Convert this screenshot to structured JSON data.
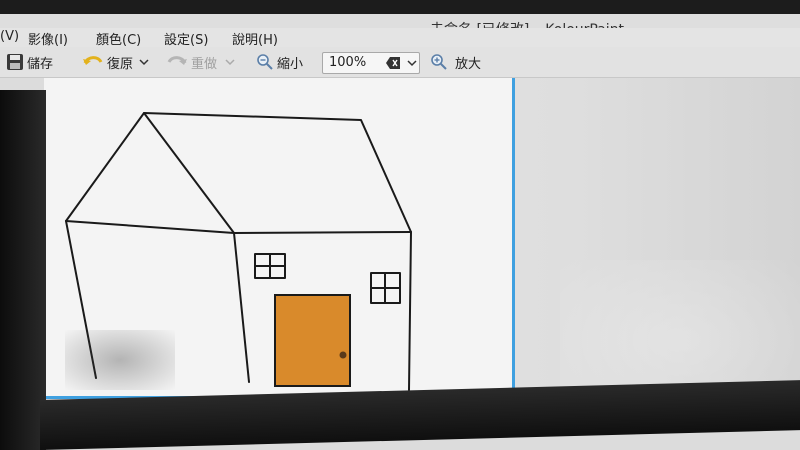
{
  "window": {
    "title": "未命名 [已修改] – KolourPaint"
  },
  "menu": {
    "items": [
      {
        "label": "(V)"
      },
      {
        "label": "影像(I)"
      },
      {
        "label": "顏色(C)"
      },
      {
        "label": "設定(S)"
      },
      {
        "label": "說明(H)"
      }
    ]
  },
  "toolbar": {
    "save_label": "儲存",
    "undo_label": "復原",
    "redo_label": "重做",
    "zoom_out_label": "縮小",
    "zoom_value": "100%",
    "zoom_in_label": "放大"
  },
  "icons": {
    "save": "save-icon",
    "undo": "undo-icon",
    "redo": "redo-icon",
    "zoom_out": "zoom-out-icon",
    "zoom_in": "zoom-in-icon",
    "clear": "clear-text-icon",
    "dropdown": "chevron-down-icon"
  },
  "colors": {
    "canvas_border": "#3fa0e0",
    "door": "#d98a2b",
    "outline": "#1a1a1a"
  }
}
